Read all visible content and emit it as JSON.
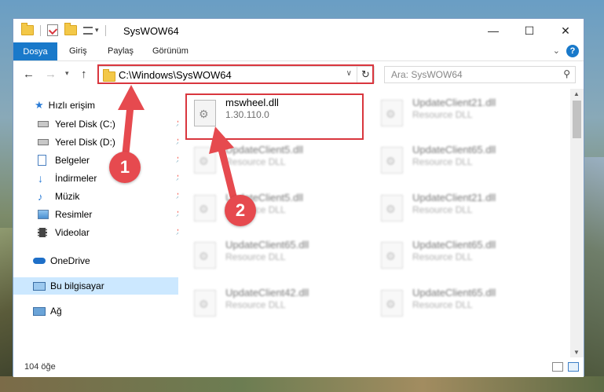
{
  "window": {
    "title": "SysWOW64",
    "controls": {
      "minimize": "—",
      "maximize": "☐",
      "close": "✕"
    }
  },
  "ribbon": {
    "file_tab": "Dosya",
    "tabs": [
      "Giriş",
      "Paylaş",
      "Görünüm"
    ],
    "help": "?"
  },
  "address_bar": {
    "path": "C:\\Windows\\SysWOW64",
    "refresh": "↻"
  },
  "search": {
    "placeholder": "Ara: SysWOW64"
  },
  "sidebar": {
    "quick_access": "Hızlı erişim",
    "items": [
      {
        "label": "Yerel Disk (C:)",
        "icon": "drive-icon"
      },
      {
        "label": "Yerel Disk (D:)",
        "icon": "drive-icon"
      },
      {
        "label": "Belgeler",
        "icon": "documents-icon"
      },
      {
        "label": "İndirmeler",
        "icon": "downloads-icon"
      },
      {
        "label": "Müzik",
        "icon": "music-icon"
      },
      {
        "label": "Resimler",
        "icon": "pictures-icon"
      },
      {
        "label": "Videolar",
        "icon": "videos-icon"
      }
    ],
    "onedrive": "OneDrive",
    "this_pc": "Bu bilgisayar",
    "network": "Ağ"
  },
  "files": {
    "highlighted": {
      "name": "mswheel.dll",
      "detail": "1.30.110.0"
    },
    "others": [
      {
        "name": "UpdateClient21.dll",
        "detail": "Resource DLL"
      },
      {
        "name": "UpdateClient5.dll",
        "detail": "Resource DLL"
      },
      {
        "name": "UpdateClient65.dll",
        "detail": "Resource DLL"
      },
      {
        "name": "UpdateClient5.dll",
        "detail": "Resource DLL"
      },
      {
        "name": "UpdateClient21.dll",
        "detail": "Resource DLL"
      },
      {
        "name": "UpdateClient65.dll",
        "detail": "Resource DLL"
      },
      {
        "name": "UpdateClient65.dll",
        "detail": "Resource DLL"
      },
      {
        "name": "UpdateClient42.dll",
        "detail": "Resource DLL"
      },
      {
        "name": "UpdateClient65.dll",
        "detail": "Resource DLL"
      }
    ]
  },
  "status": {
    "count": "104 öğe"
  },
  "annotations": {
    "step1": "1",
    "step2": "2",
    "color": "#e64a4f"
  }
}
